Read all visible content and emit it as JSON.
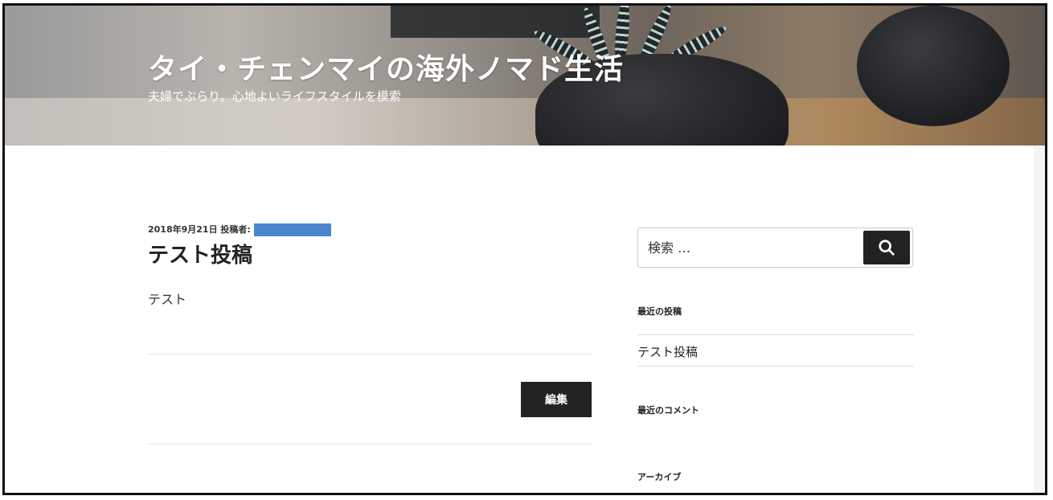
{
  "header": {
    "site_title": "タイ・チェンマイの海外ノマド生活",
    "tagline": "夫婦でぶらり。心地よいライフスタイルを模索"
  },
  "post": {
    "date": "2018年9月21日",
    "author_label": "投稿者:",
    "title": "テスト投稿",
    "body": "テスト",
    "edit_label": "編集"
  },
  "sidebar": {
    "search": {
      "placeholder": "検索 …",
      "icon": "search-icon"
    },
    "recent_posts": {
      "title": "最近の投稿",
      "items": [
        "テスト投稿"
      ]
    },
    "recent_comments": {
      "title": "最近のコメント"
    },
    "archives": {
      "title": "アーカイブ"
    }
  },
  "colors": {
    "button_bg": "#222222",
    "redaction": "#4a86d0",
    "text": "#222222"
  }
}
